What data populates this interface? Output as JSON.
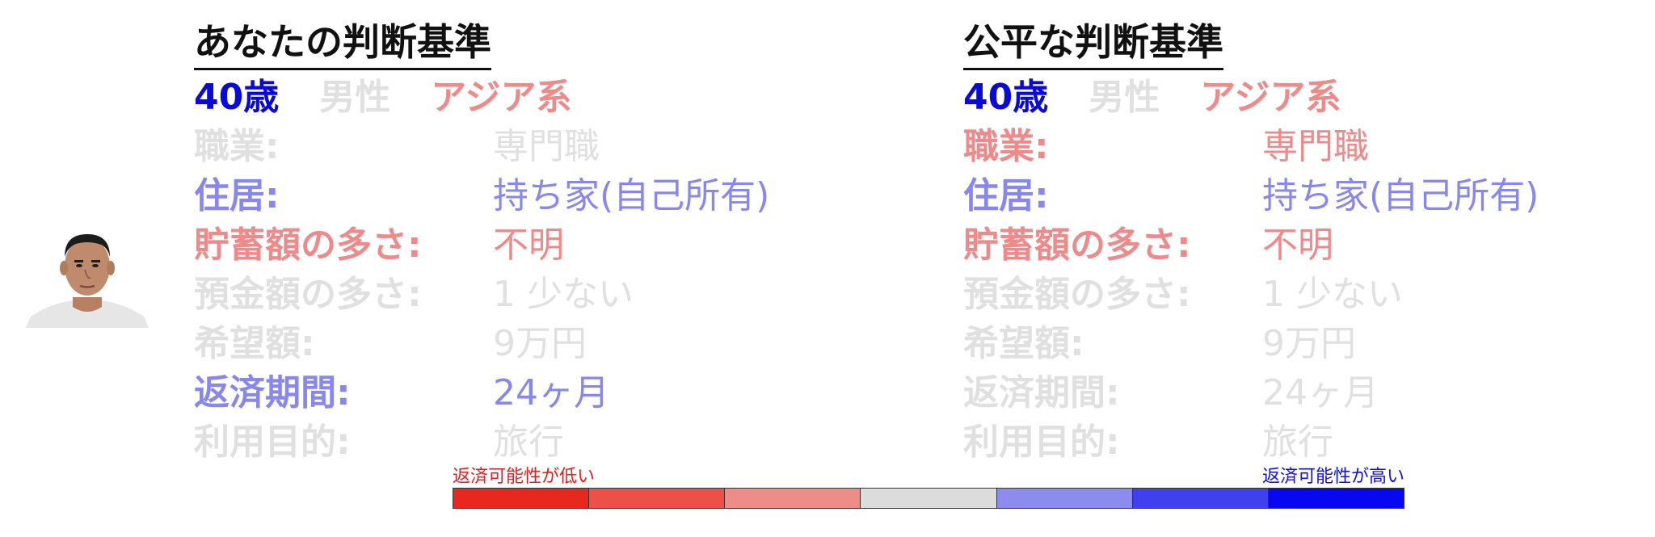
{
  "profile": {
    "age": "40歳",
    "gender": "男性",
    "ethnicity": "アジア系"
  },
  "left_panel": {
    "title": "あなたの判断基準",
    "rows": [
      {
        "label": "職業:",
        "value": "専門職",
        "tone": "neutral"
      },
      {
        "label": "住居:",
        "value": "持ち家(自己所有)",
        "tone": "positive"
      },
      {
        "label": "貯蓄額の多さ:",
        "value": "不明",
        "tone": "negative"
      },
      {
        "label": "預金額の多さ:",
        "value": "1 少ない",
        "tone": "neutral"
      },
      {
        "label": "希望額:",
        "value": "9万円",
        "tone": "neutral"
      },
      {
        "label": "返済期間:",
        "value": "24ヶ月",
        "tone": "positive"
      },
      {
        "label": "利用目的:",
        "value": "旅行",
        "tone": "neutral"
      }
    ],
    "demo_tones": {
      "age": "strong-positive",
      "gender": "neutral",
      "ethnicity": "negative"
    }
  },
  "right_panel": {
    "title": "公平な判断基準",
    "rows": [
      {
        "label": "職業:",
        "value": "専門職",
        "tone": "negative"
      },
      {
        "label": "住居:",
        "value": "持ち家(自己所有)",
        "tone": "positive"
      },
      {
        "label": "貯蓄額の多さ:",
        "value": "不明",
        "tone": "negative"
      },
      {
        "label": "預金額の多さ:",
        "value": "1 少ない",
        "tone": "neutral"
      },
      {
        "label": "希望額:",
        "value": "9万円",
        "tone": "neutral"
      },
      {
        "label": "返済期間:",
        "value": "24ヶ月",
        "tone": "neutral"
      },
      {
        "label": "利用目的:",
        "value": "旅行",
        "tone": "neutral"
      }
    ],
    "demo_tones": {
      "age": "strong-positive",
      "gender": "neutral",
      "ethnicity": "negative"
    }
  },
  "scale": {
    "low_label": "返済可能性が低い",
    "high_label": "返済可能性が高い",
    "colors": [
      "#e8281e",
      "#ec5048",
      "#ee8c88",
      "#dcdcdc",
      "#8c8cf0",
      "#4040ee",
      "#0808f0"
    ]
  },
  "tone_colors": {
    "neutral": "#e0e0e0",
    "negative": "#ee8a8a",
    "positive": "#8787ee",
    "strong-positive": "#0a0ad8"
  }
}
